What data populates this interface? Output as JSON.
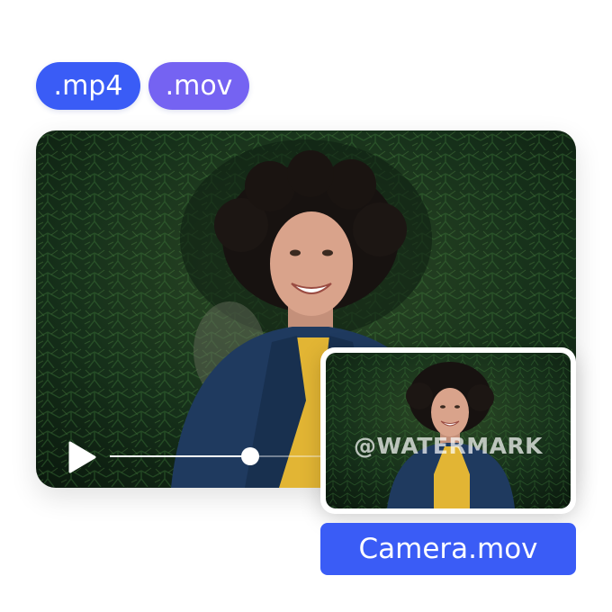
{
  "formats": [
    {
      "label": ".mp4",
      "color": "#3a5cf6"
    },
    {
      "label": ".mov",
      "color": "#7563f2"
    }
  ],
  "player": {
    "progress": 0.3,
    "play_icon": "play-icon",
    "scene": "portrait of a smiling woman with curly dark hair in a navy blazer and yellow top, surrounded by pine branches"
  },
  "thumbnail": {
    "watermark": "@WATERMARK"
  },
  "file": {
    "name": "Camera.mov",
    "color": "#3a5cf6"
  }
}
